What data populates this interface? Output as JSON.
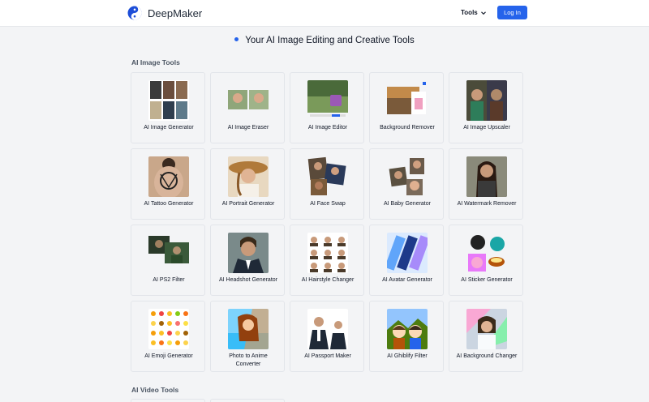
{
  "header": {
    "brand": "DeepMaker",
    "logo_icon": "yin-yang-logo-icon",
    "tools_label": "Tools",
    "login_label": "Log In",
    "accent": "#2563eb"
  },
  "hero": {
    "title": "Your AI Image Editing and Creative Tools"
  },
  "sections": {
    "image_tools_title": "AI Image Tools",
    "video_tools_title": "AI Video Tools"
  },
  "tools": [
    {
      "label": "AI Image Generator"
    },
    {
      "label": "AI Image Eraser"
    },
    {
      "label": "AI Image Editor"
    },
    {
      "label": "Background Remover"
    },
    {
      "label": "AI Image Upscaler"
    },
    {
      "label": "AI Tattoo Generator"
    },
    {
      "label": "AI Portrait Generator"
    },
    {
      "label": "AI Face Swap"
    },
    {
      "label": "AI Baby Generator"
    },
    {
      "label": "AI Watermark Remover"
    },
    {
      "label": "AI PS2 Filter"
    },
    {
      "label": "AI Headshot Generator"
    },
    {
      "label": "AI Hairstyle Changer"
    },
    {
      "label": "AI Avatar Generator"
    },
    {
      "label": "AI Sticker Generator"
    },
    {
      "label": "AI Emoji Generator"
    },
    {
      "label": "Photo to Anime Converter"
    },
    {
      "label": "AI Passport Maker"
    },
    {
      "label": "AI Ghiblify Filter"
    },
    {
      "label": "AI Background Changer"
    }
  ]
}
